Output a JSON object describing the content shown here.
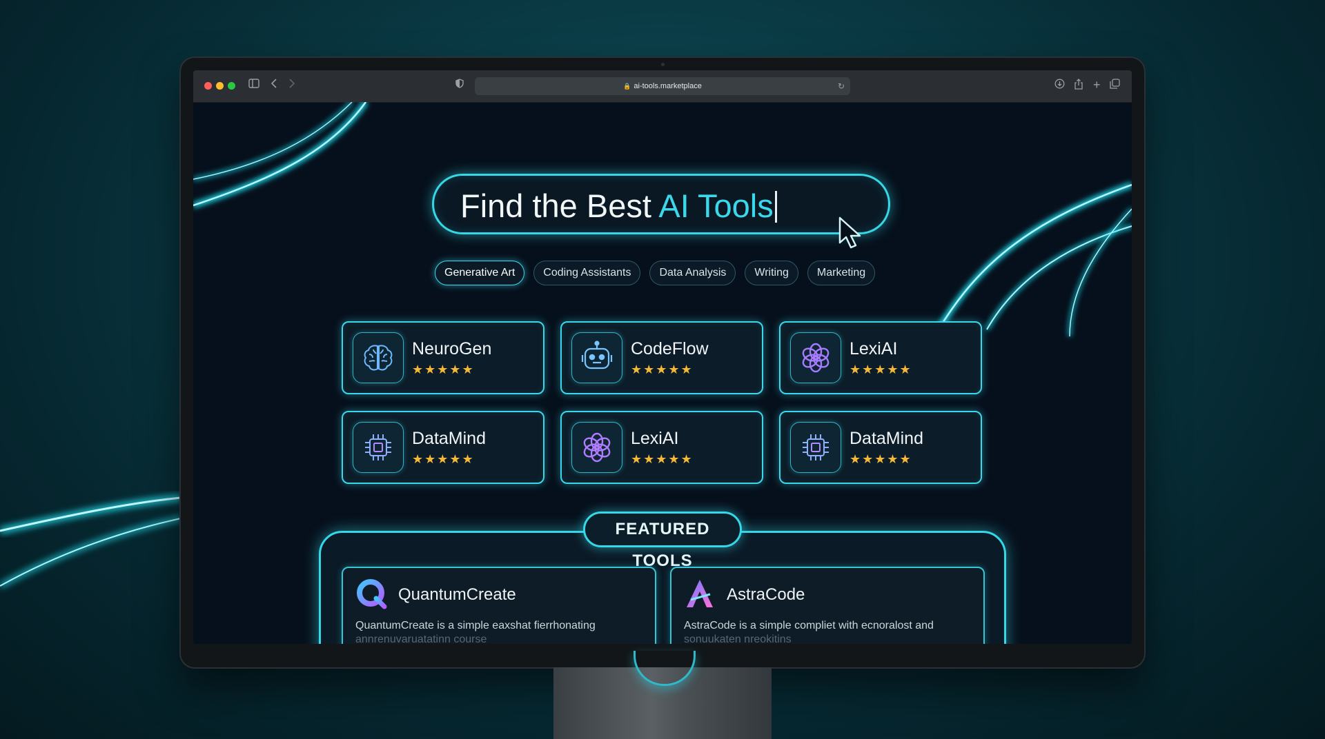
{
  "browser": {
    "url": "ai-tools.marketplace"
  },
  "search": {
    "text_main": "Find the Best ",
    "text_accent": "AI Tools"
  },
  "categories": [
    "Generative Art",
    "Coding Assistants",
    "Data Analysis",
    "Writing",
    "Marketing"
  ],
  "tools": [
    {
      "name": "NeuroGen",
      "rating": 5,
      "stars": "★★★★★",
      "icon": "brain-icon"
    },
    {
      "name": "CodeFlow",
      "rating": 5,
      "stars": "★★★★★",
      "icon": "robot-icon"
    },
    {
      "name": "LexiAI",
      "rating": 5,
      "stars": "★★★★★",
      "icon": "knot-icon"
    },
    {
      "name": "DataMind",
      "rating": 5,
      "stars": "★★★★★",
      "icon": "chip-icon"
    },
    {
      "name": "LexiAI",
      "rating": 5,
      "stars": "★★★★★",
      "icon": "knot-icon"
    },
    {
      "name": "DataMind",
      "rating": 5,
      "stars": "★★★★★",
      "icon": "chip-icon"
    }
  ],
  "featured": {
    "title": "FEATURED TOOLS",
    "cards": [
      {
        "name": "QuantumCreate",
        "desc": "QuantumCreate is a simple eaxshat fierrhonating",
        "desc2": "annrenuvaruatatinn course",
        "icon": "quantum-logo-icon"
      },
      {
        "name": "AstraCode",
        "desc": "AstraCode is a simple compliet with ecnoralost and",
        "desc2": "sonuukaten nreokitins",
        "icon": "astra-logo-icon"
      }
    ]
  },
  "colors": {
    "accent": "#3ad8ea",
    "star": "#f5b93a",
    "page_bg": "#06101c"
  }
}
